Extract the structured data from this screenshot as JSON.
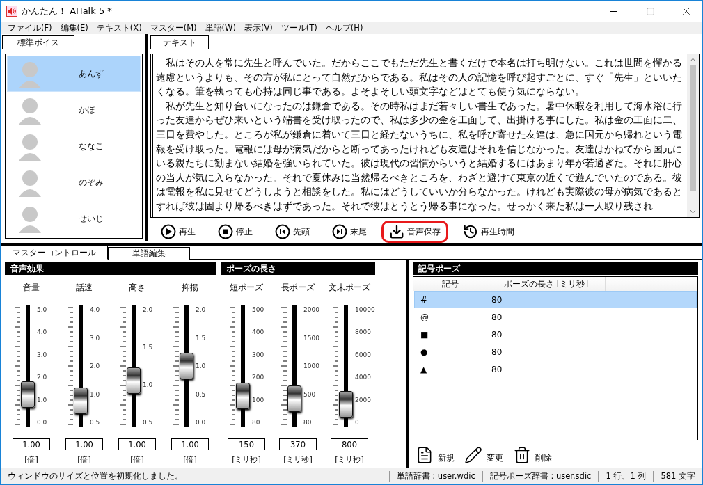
{
  "window": {
    "title": "かんたん！ AITalk 5 *"
  },
  "menu": [
    "ファイル(F)",
    "編集(E)",
    "テキスト(X)",
    "マスター(M)",
    "単語(W)",
    "表示(V)",
    "ツール(T)",
    "ヘルプ(H)"
  ],
  "voice_panel": {
    "tabs": [
      {
        "label": "標準ボイス",
        "selected": true
      }
    ],
    "voices": [
      {
        "name": "あんず",
        "selected": true
      },
      {
        "name": "かほ",
        "selected": false
      },
      {
        "name": "ななこ",
        "selected": false
      },
      {
        "name": "のぞみ",
        "selected": false
      },
      {
        "name": "せいじ",
        "selected": false
      }
    ]
  },
  "text_panel": {
    "tabs": [
      {
        "label": "テキスト",
        "selected": true
      }
    ],
    "paragraphs": [
      "私はその人を常に先生と呼んでいた。だからここでもただ先生と書くだけで本名は打ち明けない。これは世間を憚かる遠慮というよりも、その方が私にとって自然だからである。私はその人の記憶を呼び起すごとに、すぐ「先生」といいたくなる。筆を執っても心持は同じ事である。よそよそしい頭文字などはとても使う気にならない。",
      "私が先生と知り合いになったのは鎌倉である。その時私はまだ若々しい書生であった。暑中休暇を利用して海水浴に行った友達からぜひ来いという端書を受け取ったので、私は多少の金を工面して、出掛ける事にした。私は金の工面に二、三日を費やした。ところが私が鎌倉に着いて三日と経たないうちに、私を呼び寄せた友達は、急に国元から帰れという電報を受け取った。電報には母が病気だからと断ってあったけれども友達はそれを信じなかった。友達はかねてから国元にいる親たちに勧まない結婚を強いられていた。彼は現代の習慣からいうと結婚するにはあまり年が若過ぎた。それに肝心の当人が気に入らなかった。それで夏休みに当然帰るべきところを、わざと避けて東京の近くで遊んでいたのである。彼は電報を私に見せてどうしようと相談をした。私にはどうしていいか分らなかった。けれども実際彼の母が病気であるとすれば彼は固より帰るべきはずであった。それで彼はとうとう帰る事になった。せっかく来た私は一人取り残され"
    ],
    "toolbar": [
      {
        "kind": "play",
        "label": "再生",
        "highlighted": false
      },
      {
        "kind": "stop",
        "label": "停止",
        "highlighted": false
      },
      {
        "kind": "first",
        "label": "先頭",
        "highlighted": false
      },
      {
        "kind": "last",
        "label": "末尾",
        "highlighted": false
      },
      {
        "kind": "save",
        "label": "音声保存",
        "highlighted": true
      },
      {
        "kind": "time",
        "label": "再生時間",
        "highlighted": false
      }
    ]
  },
  "bottom_tabs": [
    {
      "label": "マスターコントロール",
      "selected": true
    },
    {
      "label": "単語編集",
      "selected": false
    }
  ],
  "sections": [
    {
      "title": "音声効果",
      "sliders": [
        {
          "label": "音量",
          "ticks": [
            "5.0",
            "4.0",
            "3.0",
            "2.0",
            "1.0",
            "0.0"
          ],
          "level": 0.2,
          "value": "1.00",
          "unit": "[倍]"
        },
        {
          "label": "話速",
          "ticks": [
            "4.0",
            "3.0",
            "2.0",
            "1.0",
            "0.5"
          ],
          "level": 0.14,
          "value": "1.00",
          "unit": "[倍]"
        },
        {
          "label": "高さ",
          "ticks": [
            "2.0",
            "1.5",
            "1.0",
            "0.5"
          ],
          "level": 0.35,
          "value": "1.00",
          "unit": "[倍]"
        },
        {
          "label": "抑揚",
          "ticks": [
            "2.0",
            "1.5",
            "1.0",
            "0.5",
            "0.0"
          ],
          "level": 0.5,
          "value": "1.00",
          "unit": "[倍]"
        }
      ]
    },
    {
      "title": "ポーズの長さ",
      "sliders": [
        {
          "label": "短ポーズ",
          "ticks": [
            "500",
            "400",
            "300",
            "200",
            "100",
            "80"
          ],
          "level": 0.19,
          "value": "150",
          "unit": "[ミリ秒]"
        },
        {
          "label": "長ポーズ",
          "ticks": [
            "2000",
            "1500",
            "1000",
            "500",
            "80"
          ],
          "level": 0.16,
          "value": "370",
          "unit": "[ミリ秒]"
        },
        {
          "label": "文末ポーズ",
          "ticks": [
            "10000",
            "8000",
            "6000",
            "4000",
            "2000",
            "0"
          ],
          "level": 0.1,
          "value": "800",
          "unit": "[ミリ秒]"
        }
      ]
    }
  ],
  "symbol_pause": {
    "title": "記号ポーズ",
    "columns": [
      "記号",
      "ポーズの長さ [ミリ秒]"
    ],
    "rows": [
      {
        "symbol": "#",
        "length": "80",
        "selected": true
      },
      {
        "symbol": "@",
        "length": "80",
        "selected": false
      },
      {
        "symbol": "■",
        "length": "80",
        "selected": false
      },
      {
        "symbol": "●",
        "length": "80",
        "selected": false
      },
      {
        "symbol": "▲",
        "length": "80",
        "selected": false
      }
    ],
    "actions": [
      {
        "kind": "new",
        "label": "新規"
      },
      {
        "kind": "edit",
        "label": "変更"
      },
      {
        "kind": "delete",
        "label": "削除"
      }
    ]
  },
  "status_bar": [
    "ウィンドウのサイズと位置を初期化しました。",
    "単語辞書 : user.wdic",
    "記号ポーズ辞書 : user.sdic",
    "1 行、1 列",
    "581 文字"
  ]
}
